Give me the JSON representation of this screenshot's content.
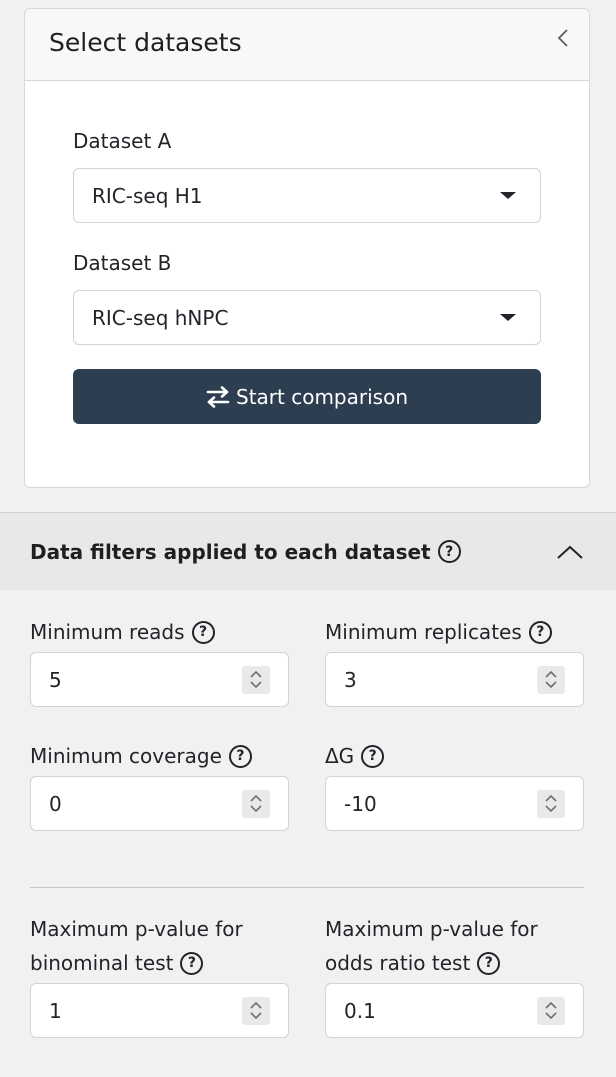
{
  "dataset_panel": {
    "title": "Select datasets",
    "dataset_a": {
      "label": "Dataset A",
      "value": "RIC-seq H1"
    },
    "dataset_b": {
      "label": "Dataset B",
      "value": "RIC-seq hNPC"
    },
    "start_label": "Start comparison"
  },
  "filters": {
    "title": "Data filters applied to each dataset",
    "min_reads": {
      "label": "Minimum reads",
      "value": "5"
    },
    "min_replicates": {
      "label": "Minimum replicates",
      "value": "3"
    },
    "min_coverage": {
      "label": "Minimum coverage",
      "value": "0"
    },
    "delta_g": {
      "label": "ΔG",
      "value": "-10"
    },
    "max_p_binominal": {
      "label_line1": "Maximum p-value for",
      "label_line2": "binominal test",
      "value": "1"
    },
    "max_p_odds": {
      "label_line1": "Maximum p-value for",
      "label_line2": "odds ratio test",
      "value": "0.1"
    }
  },
  "icons": {
    "collapse": "chevron-left-icon",
    "swap": "exchange-arrows-icon",
    "help": "question-circle-icon",
    "accordion": "chevron-up-icon",
    "help_glyph": "?"
  },
  "colors": {
    "primary_button": "#2c3e50",
    "page_background": "#f1f1f2",
    "accordion_header": "#e8e8e9"
  }
}
